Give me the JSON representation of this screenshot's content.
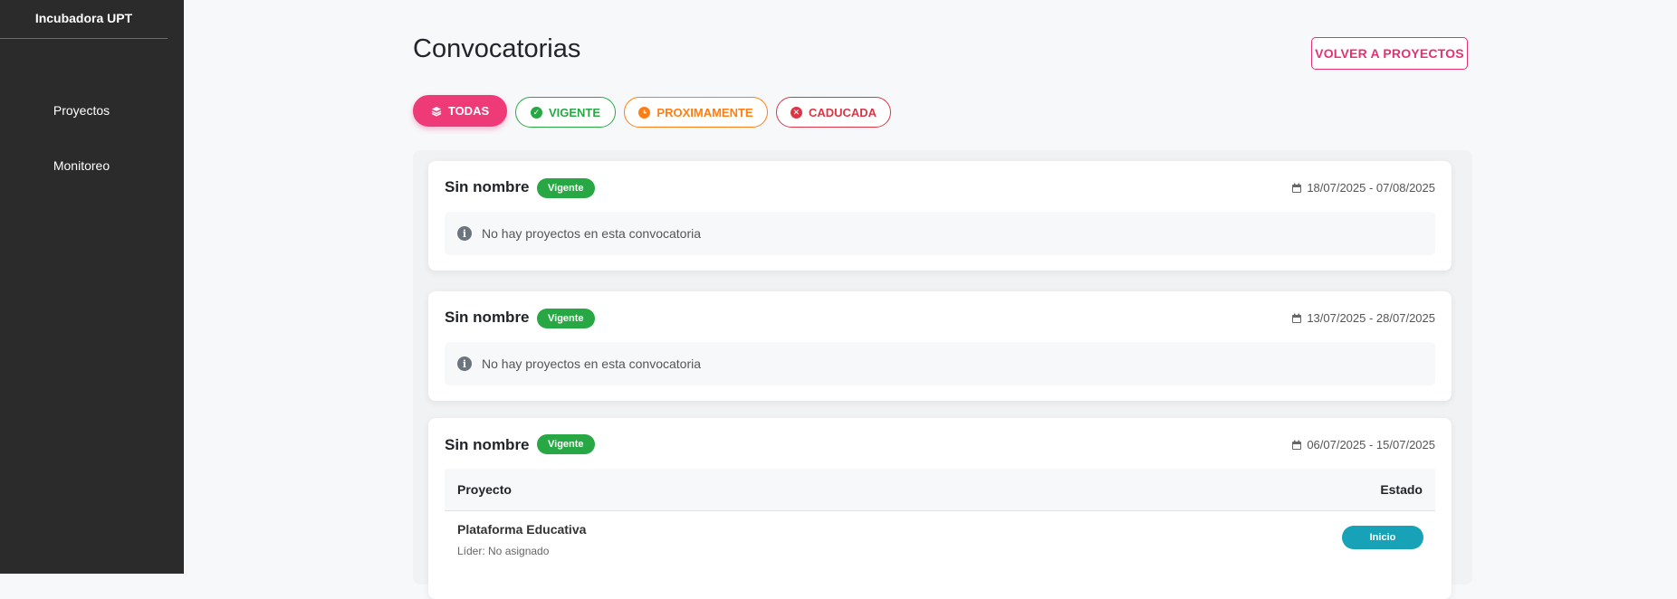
{
  "sidebar": {
    "brand": "Incubadora UPT",
    "items": [
      {
        "label": "Proyectos"
      },
      {
        "label": "Monitoreo"
      }
    ]
  },
  "header": {
    "title": "Convocatorias",
    "back_label": "VOLVER A PROYECTOS"
  },
  "filters": [
    {
      "label": "TODAS",
      "icon": "layers-icon",
      "color": "#ef3a78",
      "active": true
    },
    {
      "label": "VIGENTE",
      "icon": "check-circle-icon",
      "color": "#28a745"
    },
    {
      "label": "PROXIMAMENTE",
      "icon": "clock-icon",
      "color": "#fd7e14"
    },
    {
      "label": "CADUCADA",
      "icon": "x-circle-icon",
      "color": "#dc3545"
    }
  ],
  "convocatorias": [
    {
      "name": "Sin nombre",
      "status": "Vigente",
      "dates": "18/07/2025 - 07/08/2025",
      "empty_message": "No hay proyectos en esta convocatoria"
    },
    {
      "name": "Sin nombre",
      "status": "Vigente",
      "dates": "13/07/2025 - 28/07/2025",
      "empty_message": "No hay proyectos en esta convocatoria"
    },
    {
      "name": "Sin nombre",
      "status": "Vigente",
      "dates": "06/07/2025 - 15/07/2025",
      "table": {
        "col_project": "Proyecto",
        "col_status": "Estado",
        "rows": [
          {
            "project": "Plataforma Educativa",
            "leader": "Líder: No asignado",
            "status": "Inicio"
          }
        ]
      }
    }
  ],
  "colors": {
    "accent": "#ef3a78",
    "sidebar": "#2b2b2b",
    "vigente": "#28a745",
    "inicio": "#17a2b8"
  }
}
